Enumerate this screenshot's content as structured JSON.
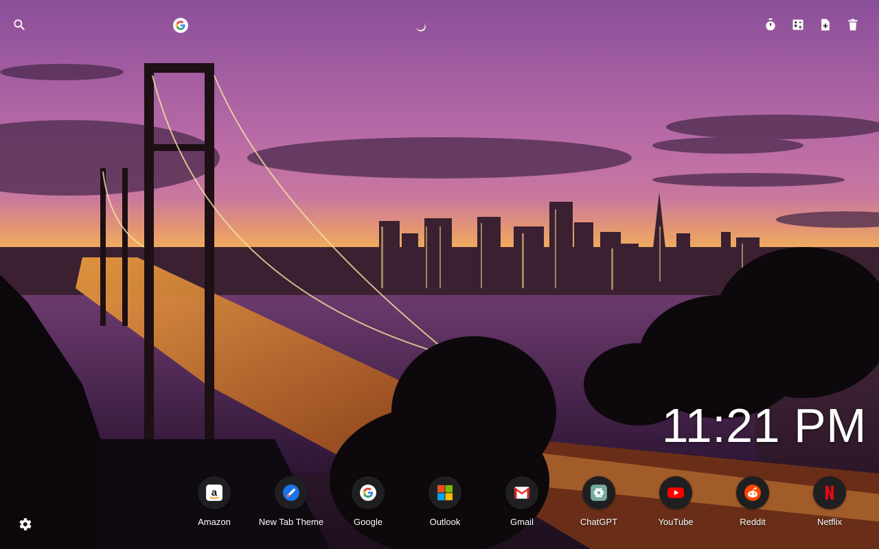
{
  "search": {
    "value": "",
    "placeholder": "",
    "engine_icon": "google-g-icon"
  },
  "toolbar": {
    "icons": [
      "timer-icon",
      "calculator-icon",
      "add-note-icon",
      "trash-icon"
    ]
  },
  "clock": {
    "time": "11:21 PM"
  },
  "shortcuts": [
    {
      "label": "Amazon",
      "icon": "amazon-icon"
    },
    {
      "label": "New Tab Theme",
      "icon": "new-tab-theme-icon"
    },
    {
      "label": "Google",
      "icon": "google-icon"
    },
    {
      "label": "Outlook",
      "icon": "outlook-icon"
    },
    {
      "label": "Gmail",
      "icon": "gmail-icon"
    },
    {
      "label": "ChatGPT",
      "icon": "chatgpt-icon"
    },
    {
      "label": "YouTube",
      "icon": "youtube-icon"
    },
    {
      "label": "Reddit",
      "icon": "reddit-icon"
    },
    {
      "label": "Netflix",
      "icon": "netflix-icon"
    }
  ],
  "settings": {
    "icon": "gear-icon"
  },
  "colors": {
    "sky_top": "#8a4f9a",
    "sky_horizon": "#f2a24a",
    "water": "#5a2f5e",
    "shortcut_bg": "#1f1f22"
  }
}
